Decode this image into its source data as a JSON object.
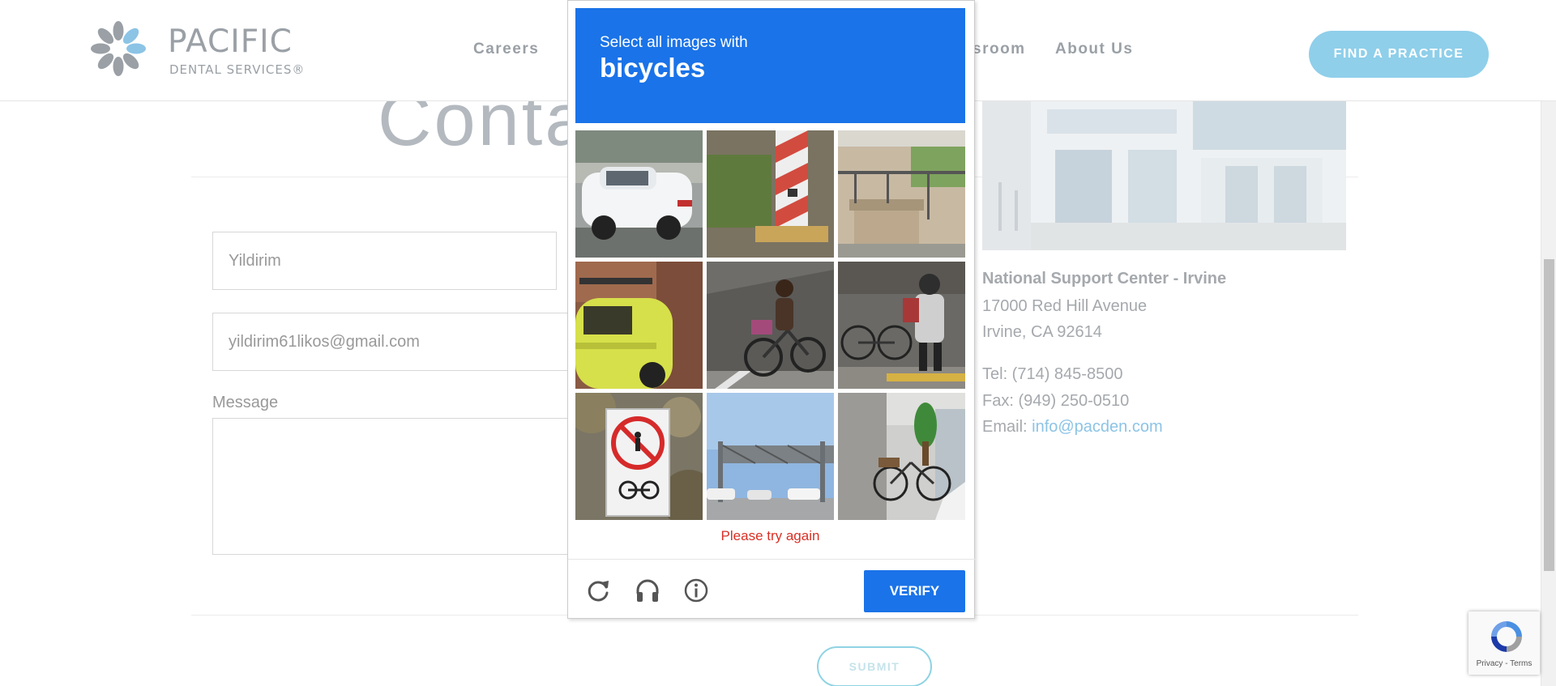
{
  "header": {
    "logo_main": "PACIFIC",
    "logo_sub": "DENTAL SERVICES®",
    "nav": [
      {
        "label": "Careers"
      },
      {
        "label": "sroom"
      },
      {
        "label": "About Us"
      }
    ],
    "cta_label": "FIND A PRACTICE"
  },
  "page": {
    "title": "Conta"
  },
  "form": {
    "name_value": "Yildirim",
    "email_value": "yildirim61likos@gmail.com",
    "message_label": "Message",
    "message_value": "",
    "submit_label": "SUBMIT"
  },
  "office": {
    "name": "National Support Center - Irvine",
    "address_line1": "17000 Red Hill Avenue",
    "address_line2": "Irvine, CA 92614",
    "tel": "Tel: (714) 845-8500",
    "fax": "Fax: (949) 250-0510",
    "email_label": "Email: ",
    "email_link": "info@pacden.com"
  },
  "captcha": {
    "prompt": "Select all images with",
    "target": "bicycles",
    "error": "Please try again",
    "verify_label": "VERIFY",
    "tiles": [
      {
        "content": "white car on street"
      },
      {
        "content": "striped traffic post"
      },
      {
        "content": "wall with railing"
      },
      {
        "content": "yellow-green car"
      },
      {
        "content": "woman riding bicycle"
      },
      {
        "content": "man with parked bicycles"
      },
      {
        "content": "no cycling sign"
      },
      {
        "content": "highway sign gantry"
      },
      {
        "content": "bicycle by storefront"
      }
    ],
    "controls": [
      "reload-icon",
      "headphones-icon",
      "info-icon"
    ],
    "accent_color": "#1a73e8",
    "error_color": "#d93025"
  },
  "recaptcha_badge": {
    "terms": "Privacy - Terms"
  }
}
